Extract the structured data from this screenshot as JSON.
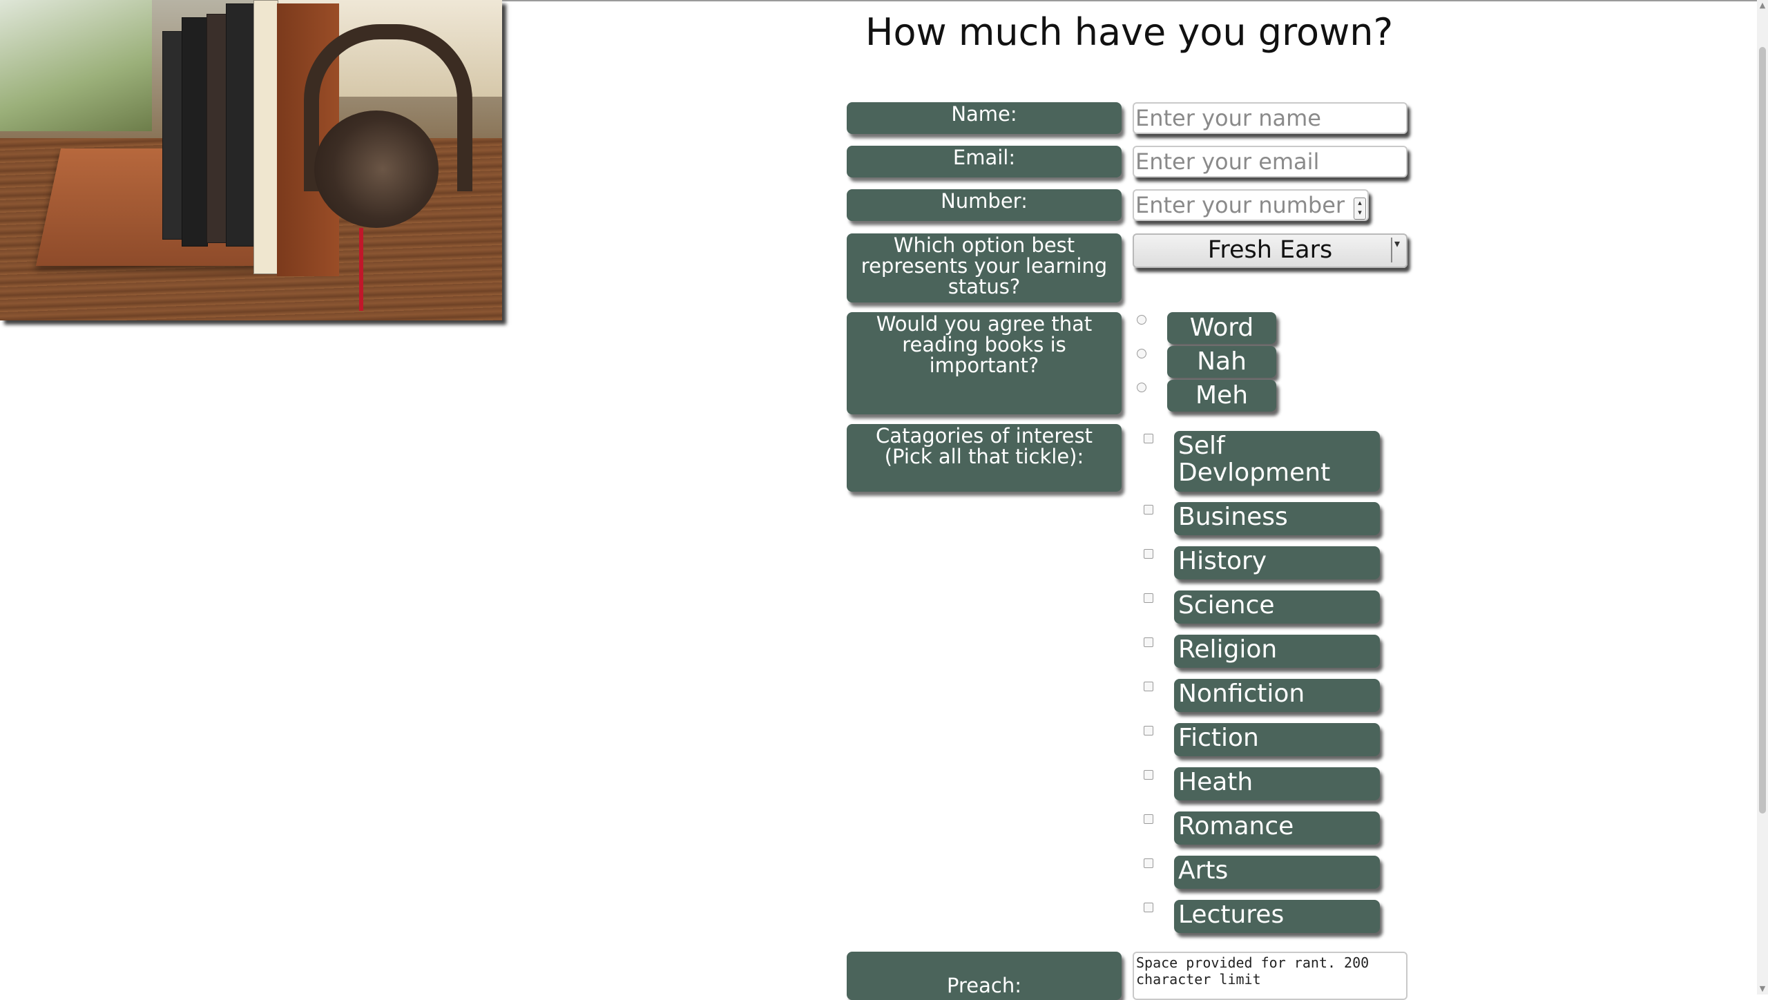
{
  "page": {
    "title": "How much have you grown?"
  },
  "colors": {
    "label_bg": "#4b645b",
    "label_text": "#ffffff"
  },
  "form": {
    "name": {
      "label": "Name:",
      "placeholder": "Enter your name"
    },
    "email": {
      "label": "Email:",
      "placeholder": "Enter your email"
    },
    "number": {
      "label": "Number:",
      "placeholder": "Enter your number"
    },
    "status": {
      "label": "Which option best represents your learning status?",
      "selected": "Fresh Ears"
    },
    "reading": {
      "label": "Would you agree that reading books is important?",
      "options": [
        "Word",
        "Nah",
        "Meh"
      ]
    },
    "categories": {
      "label": "Catagories of interest (Pick all that tickle):",
      "options": [
        "Self Devlopment",
        "Business",
        "History",
        "Science",
        "Religion",
        "Nonfiction",
        "Fiction",
        "Heath",
        "Romance",
        "Arts",
        "Lectures"
      ]
    },
    "preach": {
      "label": "Preach:",
      "placeholder": "Space provided for rant. 200 character limit"
    }
  },
  "icons": {
    "number_spinner": "spinner-arrows-icon",
    "select_arrow": "chevron-down-icon"
  }
}
